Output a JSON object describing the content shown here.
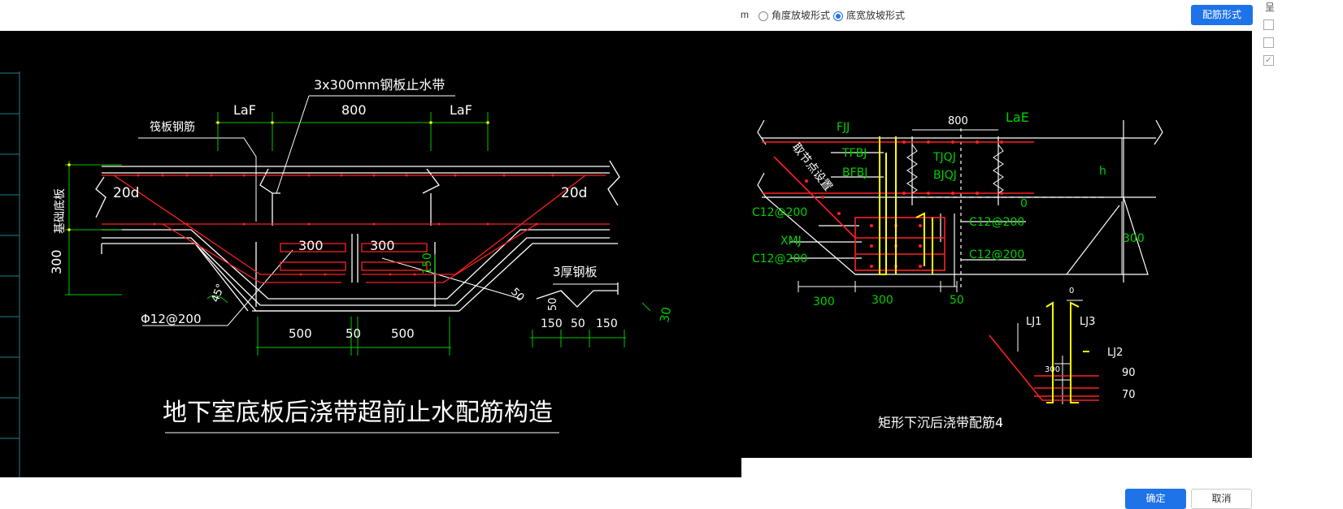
{
  "options": {
    "unit_fragment": "m",
    "radio_angle_label": "角度放坡形式",
    "radio_width_label": "底宽放坡形式",
    "selected": "底宽放坡形式",
    "config_button": "配筋形式"
  },
  "side": {
    "top_char": "呈"
  },
  "left_drawing": {
    "title": "地下室底板后浇带超前止水配筋构造",
    "labels": {
      "waterstop": "3x300mm钢板止水带",
      "raft_rebar": "筏板钢筋",
      "foundation_slab": "基础底板",
      "laf_left": "LaF",
      "laf_right": "LaF",
      "dim_800": "800",
      "d20_left": "20d",
      "d20_right": "20d",
      "dim_300_a": "300",
      "dim_300_b": "300",
      "dim_300_side": "300",
      "dim_150": "150",
      "angle": "45°",
      "stirrup": "Φ12@200",
      "plate": "3厚钢板",
      "dim_50_slope": "50",
      "dim_500_l": "500",
      "dim_50_mid": "50",
      "dim_500_r": "500",
      "dim_50_v": "50",
      "dim_150_l": "150",
      "dim_50_b": "50",
      "dim_150_r": "150",
      "dim_30": "30"
    }
  },
  "right_drawing": {
    "title": "矩形下沉后浇带配筋4",
    "labels": {
      "fjj": "FJJ",
      "dim_800": "800",
      "lae": "LaE",
      "h": "h",
      "tfbj": "TFBJ",
      "bfbj": "BFBJ",
      "tjqj": "TJQJ",
      "bjqj": "BJQJ",
      "cut_point": "取节点设置",
      "zero_a": "0",
      "c12_a": "C12@200",
      "c12_b": "C12@200",
      "c12_c": "C12@200",
      "c12_d": "C12@200",
      "xmj": "XMJ",
      "dim_300_right": "300",
      "dim_300_a": "300",
      "dim_300_b": "300",
      "dim_50": "50",
      "zero_b": "0",
      "lj1": "LJ1",
      "lj3": "LJ3",
      "lj2": "LJ2",
      "detail_300": "300",
      "dim_90": "90",
      "dim_70": "70"
    }
  },
  "footer": {
    "ok_button": "确定",
    "cancel_button": "取消"
  },
  "colors": {
    "accent": "#1e73e8",
    "canvas": "#000000",
    "rebar": "#ff2020",
    "dimension": "#00c800",
    "highlight": "#ffff00",
    "line": "#ffffff"
  }
}
